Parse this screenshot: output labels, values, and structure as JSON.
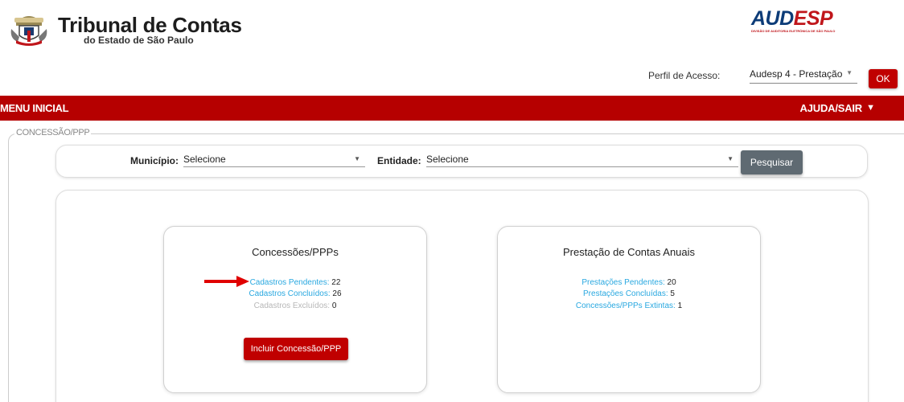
{
  "header": {
    "org_title": "Tribunal de Contas",
    "org_subtitle": "do Estado de São Paulo",
    "brand_left": "AUD",
    "brand_right": "ESP",
    "brand_tagline": "DIVISÃO DE AUDITORIA ELETRÔNICA DE SÃO PAULO"
  },
  "profile": {
    "label": "Perfil de Acesso:",
    "value": "Audesp 4 - Prestação",
    "ok_label": "OK"
  },
  "menubar": {
    "left": "MENU INICIAL",
    "right": "AJUDA/SAIR"
  },
  "section": {
    "legend": "CONCESSÃO/PPP"
  },
  "filters": {
    "municipio_label": "Município:",
    "municipio_value": "Selecione",
    "entidade_label": "Entidade:",
    "entidade_value": "Selecione",
    "search_label": "Pesquisar"
  },
  "card_concessoes": {
    "title": "Concessões/PPPs",
    "stats": [
      {
        "label": "Cadastros Pendentes:",
        "value": "22"
      },
      {
        "label": "Cadastros Concluídos:",
        "value": "26"
      },
      {
        "label": "Cadastros Excluídos:",
        "value": "0"
      }
    ],
    "button_label": "Incluir Concessão/PPP"
  },
  "card_prestacao": {
    "title": "Prestação de Contas Anuais",
    "stats": [
      {
        "label": "Prestações Pendentes:",
        "value": "20"
      },
      {
        "label": "Prestações Concluídas:",
        "value": "5"
      },
      {
        "label": "Concessões/PPPs Extintas:",
        "value": "1"
      }
    ]
  },
  "colors": {
    "brand_red": "#b60000",
    "link_blue": "#29a8e0",
    "muted_gray": "#b7b7b7",
    "button_gray": "#5f6a72"
  },
  "icons": [
    "coat-of-arms-logo",
    "dropdown-caret-icon",
    "red-arrow-icon"
  ]
}
